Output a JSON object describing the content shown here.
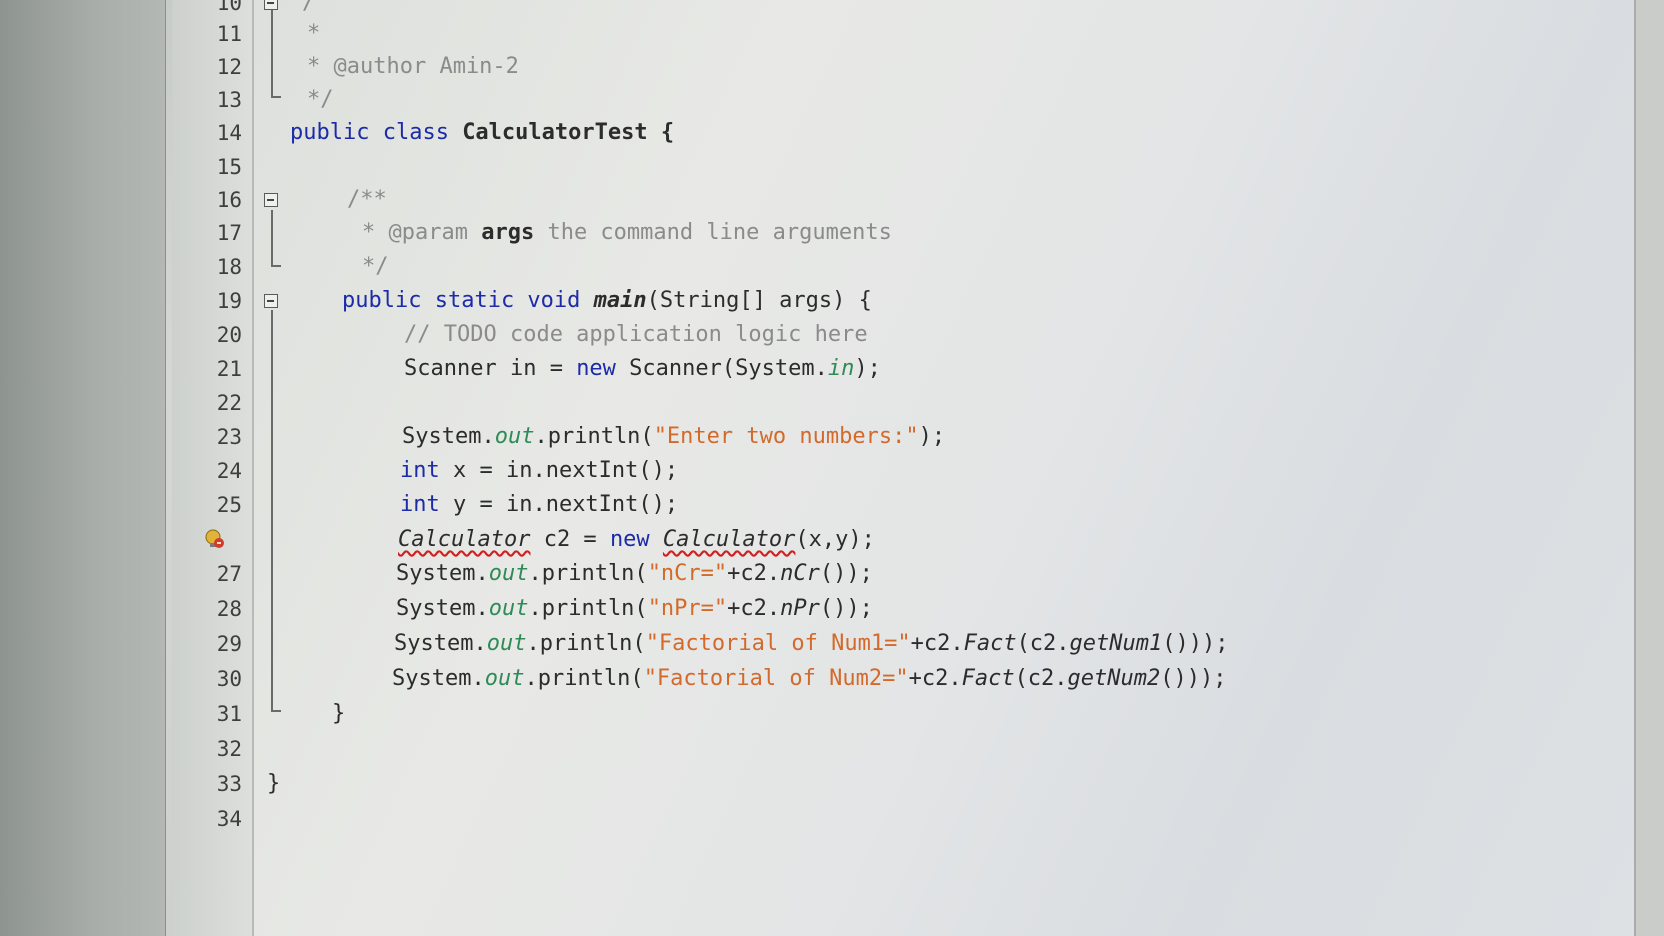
{
  "editor": {
    "lines": [
      {
        "num": "10",
        "segments": [
          {
            "t": "/",
            "c": "cmt"
          }
        ]
      },
      {
        "num": "11",
        "segments": [
          {
            "t": "*",
            "c": "cmt"
          }
        ]
      },
      {
        "num": "12",
        "segments": [
          {
            "t": "* @author Amin-2",
            "c": "cmt"
          }
        ]
      },
      {
        "num": "13",
        "segments": [
          {
            "t": "*/",
            "c": "cmt"
          }
        ]
      },
      {
        "num": "14",
        "segments": [
          {
            "t": "public class ",
            "c": "kw"
          },
          {
            "t": "CalculatorTest {",
            "c": "bold"
          }
        ]
      },
      {
        "num": "15",
        "segments": []
      },
      {
        "num": "16",
        "segments": [
          {
            "t": "/**",
            "c": "cmt"
          }
        ]
      },
      {
        "num": "17",
        "segments": [
          {
            "t": "* @param ",
            "c": "cmt"
          },
          {
            "t": "args",
            "c": "bold"
          },
          {
            "t": " the command line arguments",
            "c": "cmt"
          }
        ]
      },
      {
        "num": "18",
        "segments": [
          {
            "t": "*/",
            "c": "cmt"
          }
        ]
      },
      {
        "num": "19",
        "segments": [
          {
            "t": "public static void ",
            "c": "kw"
          },
          {
            "t": "main",
            "c": "bold it"
          },
          {
            "t": "(String[] args) {",
            "c": ""
          }
        ]
      },
      {
        "num": "20",
        "segments": [
          {
            "t": "// TODO code application logic here",
            "c": "cmt"
          }
        ]
      },
      {
        "num": "21",
        "segments": [
          {
            "t": "Scanner in = ",
            "c": ""
          },
          {
            "t": "new ",
            "c": "kw"
          },
          {
            "t": "Scanner(System.",
            "c": ""
          },
          {
            "t": "in",
            "c": "fld"
          },
          {
            "t": ");",
            "c": ""
          }
        ]
      },
      {
        "num": "22",
        "segments": []
      },
      {
        "num": "23",
        "segments": [
          {
            "t": "System.",
            "c": ""
          },
          {
            "t": "out",
            "c": "fld"
          },
          {
            "t": ".println(",
            "c": ""
          },
          {
            "t": "\"Enter two numbers:\"",
            "c": "str"
          },
          {
            "t": ");",
            "c": ""
          }
        ]
      },
      {
        "num": "24",
        "segments": [
          {
            "t": "int ",
            "c": "kw"
          },
          {
            "t": "x = in.nextInt();",
            "c": ""
          }
        ]
      },
      {
        "num": "25",
        "segments": [
          {
            "t": "int ",
            "c": "kw"
          },
          {
            "t": "y = in.nextInt();",
            "c": ""
          }
        ]
      },
      {
        "num": "",
        "segments": [
          {
            "t": "Calculator",
            "c": "err"
          },
          {
            "t": " c2 = ",
            "c": ""
          },
          {
            "t": "new ",
            "c": "kw"
          },
          {
            "t": "Calculator",
            "c": "err"
          },
          {
            "t": "(x,y);",
            "c": ""
          }
        ]
      },
      {
        "num": "27",
        "segments": [
          {
            "t": "System.",
            "c": ""
          },
          {
            "t": "out",
            "c": "fld"
          },
          {
            "t": ".println(",
            "c": ""
          },
          {
            "t": "\"nCr=\"",
            "c": "str"
          },
          {
            "t": "+c2.",
            "c": ""
          },
          {
            "t": "nCr",
            "c": "it"
          },
          {
            "t": "());",
            "c": ""
          }
        ]
      },
      {
        "num": "28",
        "segments": [
          {
            "t": "System.",
            "c": ""
          },
          {
            "t": "out",
            "c": "fld"
          },
          {
            "t": ".println(",
            "c": ""
          },
          {
            "t": "\"nPr=\"",
            "c": "str"
          },
          {
            "t": "+c2.",
            "c": ""
          },
          {
            "t": "nPr",
            "c": "it"
          },
          {
            "t": "());",
            "c": ""
          }
        ]
      },
      {
        "num": "29",
        "segments": [
          {
            "t": "System.",
            "c": ""
          },
          {
            "t": "out",
            "c": "fld"
          },
          {
            "t": ".println(",
            "c": ""
          },
          {
            "t": "\"Factorial of Num1=\"",
            "c": "str"
          },
          {
            "t": "+c2.",
            "c": ""
          },
          {
            "t": "Fact",
            "c": "it"
          },
          {
            "t": "(c2.",
            "c": ""
          },
          {
            "t": "getNum1",
            "c": "it"
          },
          {
            "t": "()));",
            "c": ""
          }
        ]
      },
      {
        "num": "30",
        "segments": [
          {
            "t": "System.",
            "c": ""
          },
          {
            "t": "out",
            "c": "fld"
          },
          {
            "t": ".println(",
            "c": ""
          },
          {
            "t": "\"Factorial of Num2=\"",
            "c": "str"
          },
          {
            "t": "+c2.",
            "c": ""
          },
          {
            "t": "Fact",
            "c": "it"
          },
          {
            "t": "(c2.",
            "c": ""
          },
          {
            "t": "getNum2",
            "c": "it"
          },
          {
            "t": "()));",
            "c": ""
          }
        ]
      },
      {
        "num": "31",
        "segments": [
          {
            "t": "}",
            "c": ""
          }
        ]
      },
      {
        "num": "32",
        "segments": []
      },
      {
        "num": "33",
        "segments": [
          {
            "t": "}",
            "c": ""
          }
        ]
      },
      {
        "num": "34",
        "segments": []
      }
    ],
    "error_line_icon": "error-bulb-icon"
  },
  "colors": {
    "keyword": "#1c2ba8",
    "comment": "#8b8b8b",
    "string": "#d36a2b",
    "field": "#2e8b57",
    "error_underline": "#d02020"
  }
}
